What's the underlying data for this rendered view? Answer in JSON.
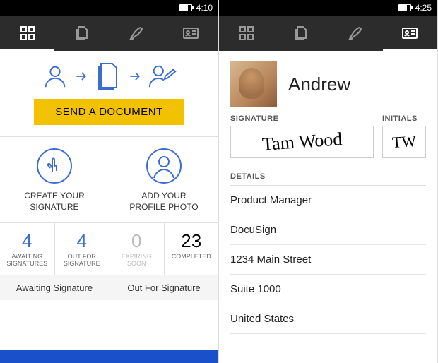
{
  "screen1": {
    "time": "4:10",
    "send_button": "SEND A DOCUMENT",
    "create_signature": "CREATE YOUR\nSIGNATURE",
    "add_photo": "ADD YOUR\nPROFILE PHOTO",
    "stats": [
      {
        "value": "4",
        "label": "AWAITING\nSIGNATURES",
        "style": "blue"
      },
      {
        "value": "4",
        "label": "OUT FOR\nSIGNATURE",
        "style": "blue"
      },
      {
        "value": "0",
        "label": "EXPIRING\nSOON",
        "style": "gray"
      },
      {
        "value": "23",
        "label": "COMPLETED",
        "style": ""
      }
    ],
    "bottom_tabs": [
      "Awaiting Signature",
      "Out For Signature"
    ]
  },
  "screen2": {
    "time": "4:25",
    "name": "Andrew",
    "signature_label": "SIGNATURE",
    "initials_label": "INITIALS",
    "signature_text": "Tam Wood",
    "initials_text": "TW",
    "details_heading": "DETAILS",
    "details": [
      "Product Manager",
      "DocuSign",
      "1234 Main Street",
      "Suite 1000",
      "United States"
    ]
  },
  "colors": {
    "accent_blue": "#3b6dd1",
    "footer_blue": "#1a50c9",
    "send_yellow": "#f2c100",
    "tabbar_dark": "#2c2c2c"
  }
}
